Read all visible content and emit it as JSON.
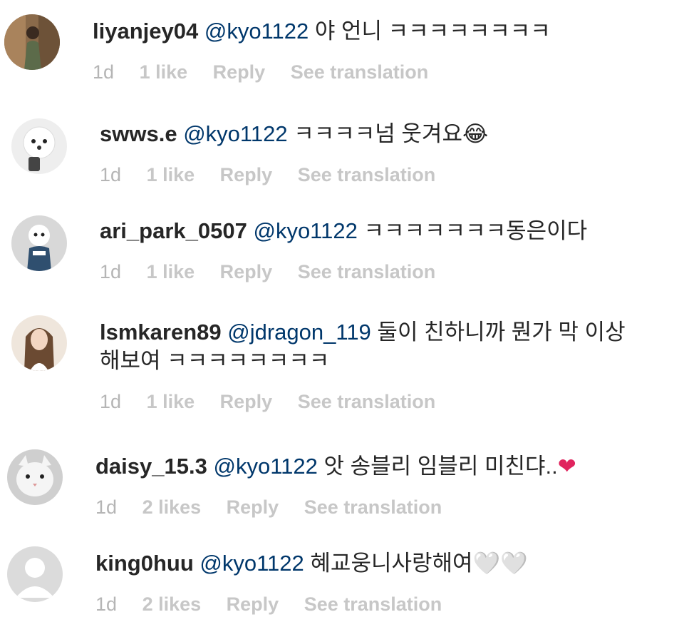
{
  "comments": [
    {
      "username": "liyanjey04",
      "mention": "@kyo1122",
      "text": "야 언니 ㅋㅋㅋㅋㅋㅋㅋㅋ",
      "text2": "",
      "emoji": "",
      "age": "1d",
      "likes": "1 like",
      "reply": "Reply",
      "translate": "See translation",
      "avatar": "woman-mirror-selfie"
    },
    {
      "username": "swws.e",
      "mention": "@kyo1122",
      "text": "ㅋㅋㅋㅋ넘 웃겨요",
      "text2": "",
      "emoji": "😂",
      "age": "1d",
      "likes": "1 like",
      "reply": "Reply",
      "translate": "See translation",
      "avatar": "white-poodle"
    },
    {
      "username": "ari_park_0507",
      "mention": "@kyo1122",
      "text": "ㅋㅋㅋㅋㅋㅋㅋ동은이다",
      "text2": "",
      "emoji": "",
      "age": "1d",
      "likes": "1 like",
      "reply": "Reply",
      "translate": "See translation",
      "avatar": "white-dog-sweater"
    },
    {
      "username": "lsmkaren89",
      "mention": "@jdragon_119",
      "text": "둘이 친하니까 뭔가 막 이상",
      "text2": "해보여 ㅋㅋㅋㅋㅋㅋㅋㅋ",
      "emoji": "",
      "age": "1d",
      "likes": "1 like",
      "reply": "Reply",
      "translate": "See translation",
      "avatar": "woman-long-hair"
    },
    {
      "username": "daisy_15.3",
      "mention": "@kyo1122",
      "text": "앗 송블리 임블리 미친댜..",
      "text2": "",
      "emoji": "❤",
      "age": "1d",
      "likes": "2 likes",
      "reply": "Reply",
      "translate": "See translation",
      "avatar": "white-cat"
    },
    {
      "username": "king0huu",
      "mention": "@kyo1122",
      "text": "혜교웅니사랑해여",
      "text2": "",
      "emoji": "🤍🤍",
      "age": "1d",
      "likes": "2 likes",
      "reply": "Reply",
      "translate": "See translation",
      "avatar": "default-avatar"
    }
  ]
}
